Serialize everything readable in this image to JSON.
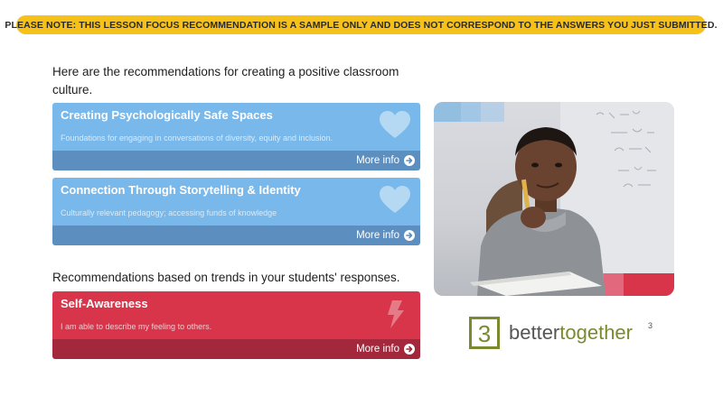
{
  "notice": "PLEASE NOTE: THIS LESSON FOCUS RECOMMENDATION IS A SAMPLE ONLY AND DOES NOT CORRESPOND TO THE ANSWERS YOU JUST SUBMITTED.",
  "intro": "Here are the recommendations for creating a positive classroom culture.",
  "trends_heading": "Recommendations based on trends in your students' responses.",
  "cards": [
    {
      "title": "Creating Psychologically Safe Spaces",
      "description": "Foundations for engaging in conversations of diversity, equity and inclusion.",
      "more_label": "More info",
      "icon": "heart-icon",
      "color": "#79b8ea"
    },
    {
      "title": "Connection Through Storytelling & Identity",
      "description": "Culturally relevant pedagogy; accessing funds of knowledge",
      "more_label": "More info",
      "icon": "heart-icon",
      "color": "#79b8ea"
    },
    {
      "title": "Self-Awareness",
      "description": "I am able to describe my feeling to others.",
      "more_label": "More info",
      "icon": "lightning-icon",
      "color": "#d8354a"
    }
  ],
  "logo": {
    "mark": "3",
    "word_better": "better",
    "word_together": "together",
    "superscript": "3",
    "color_green": "#7a8b2f",
    "color_gray": "#555555"
  },
  "colors": {
    "notice_bg": "#f6c21a",
    "blue_card": "#79b8ea",
    "blue_bar": "#5c8fbf",
    "red_card": "#d8354a",
    "red_bar": "#a3283c"
  }
}
